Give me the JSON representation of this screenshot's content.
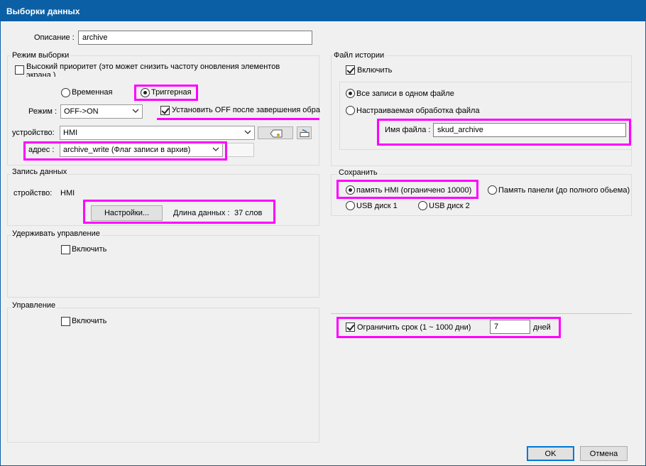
{
  "window": {
    "title": "Выборки данных"
  },
  "description": {
    "label": "Описание :",
    "value": "archive"
  },
  "sampling_mode": {
    "title": "Режим выборки",
    "high_priority_label": "Высокий приоритет (это может снизить частоту оновления элементов",
    "high_priority_label2": "экрана )",
    "time_label": "Временная",
    "trigger_label": "Триггерная",
    "mode_label": "Режим :",
    "mode_value": "OFF->ON",
    "set_off_label": "Установить OFF после завершения обра",
    "device_label": "устройство:",
    "device_value": "HMI",
    "address_label": "адрес :",
    "address_value": "archive_write (Флаг записи в архив)"
  },
  "data_record": {
    "title": "Запись данных",
    "device_label": "стройство:",
    "device_value": "HMI",
    "settings_button": "Настройки...",
    "length_label": "Длина данных :",
    "length_value": "37 слов"
  },
  "hold_control": {
    "title": "Удерживать управление",
    "enable_label": "Включить"
  },
  "control": {
    "title": "Управление",
    "enable_label": "Включить"
  },
  "history_file": {
    "title": "Файл истории",
    "enable_label": "Включить",
    "all_in_one_label": "Все записи в одном файле",
    "custom_label": "Настраиваемая обработка файла",
    "filename_label": "Имя файла :",
    "filename_value": "skud_archive"
  },
  "save": {
    "title": "Сохранить",
    "hmi_memory_label": "память HMI (ограничено 10000)",
    "panel_memory_label": "Память панели (до полного обьема)",
    "usb1_label": "USB диск 1",
    "usb2_label": "USB диск 2"
  },
  "limit": {
    "label": "Ограничить срок (1 ~ 1000 дни)",
    "value": "7",
    "unit": "дней"
  },
  "buttons": {
    "ok": "OK",
    "cancel": "Отмена"
  },
  "colors": {
    "titlebar": "#0b5fa5",
    "highlight": "#ff00ff",
    "background": "#f0f0f0"
  }
}
